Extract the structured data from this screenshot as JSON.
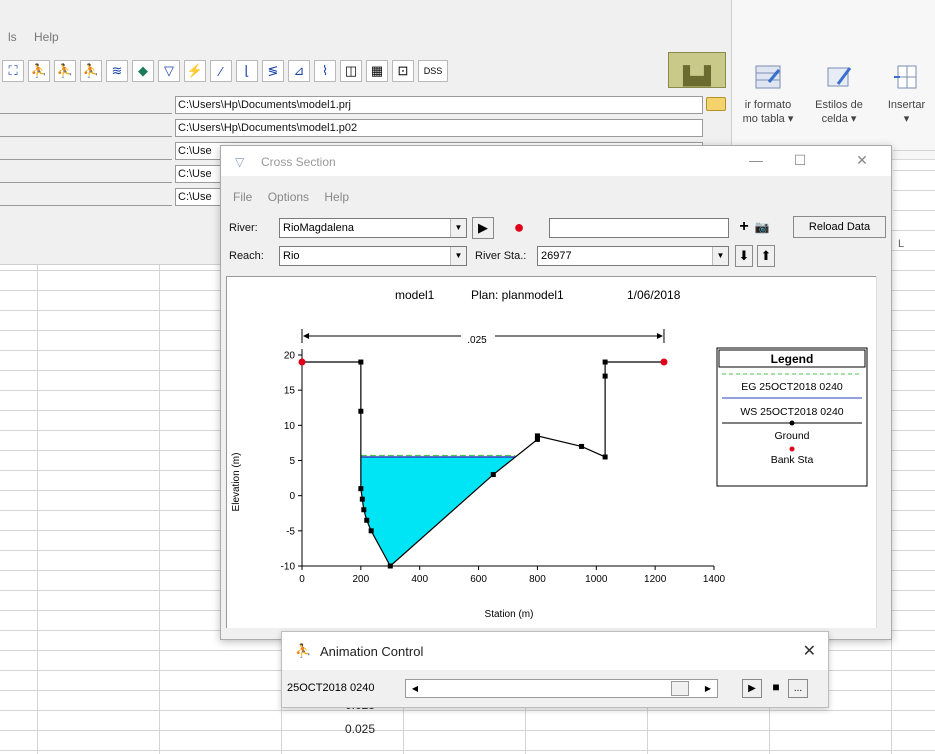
{
  "excel": {
    "ribbon_buttons": [
      {
        "line1": "ir formato",
        "line2": "mo tabla ▾"
      },
      {
        "line1": "Estilos de",
        "line2": "celda ▾"
      },
      {
        "line1": "Insertar",
        "line2": "▾"
      }
    ],
    "column_letter": "L",
    "cell_values": [
      "0.025",
      "0.025"
    ]
  },
  "hecras": {
    "menu": [
      "ls",
      "Help"
    ],
    "file_paths": [
      "C:\\Users\\Hp\\Documents\\model1.prj",
      "C:\\Users\\Hp\\Documents\\model1.p02",
      "C:\\Use",
      "C:\\Use",
      "C:\\Use"
    ],
    "dss_label": "DSS"
  },
  "cross_section": {
    "title": "Cross Section",
    "menu": [
      "File",
      "Options",
      "Help"
    ],
    "river_label": "River:",
    "river_value": "RioMagdalena",
    "reach_label": "Reach:",
    "reach_value": "Rio",
    "river_sta_label": "River Sta.:",
    "river_sta_value": "26977",
    "reload_label": "Reload Data",
    "plot_title": {
      "model": "model1",
      "plan": "Plan: planmodel1",
      "date": "1/06/2018"
    },
    "legend": {
      "title": "Legend",
      "eg": "EG 25OCT2018 0240",
      "ws": "WS 25OCT2018 0240",
      "ground": "Ground",
      "bank": "Bank Sta"
    },
    "mannings_label": ".025"
  },
  "animation": {
    "title": "Animation Control",
    "time": "25OCT2018 0240",
    "more_label": "..."
  },
  "chart_data": {
    "type": "line",
    "xlabel": "Station (m)",
    "ylabel": "Elevation (m)",
    "xlim": [
      0,
      1400
    ],
    "ylim": [
      -10,
      20
    ],
    "xticks": [
      0,
      200,
      400,
      600,
      800,
      1000,
      1200,
      1400
    ],
    "yticks": [
      -10,
      -5,
      0,
      5,
      10,
      15,
      20
    ],
    "water_surface": 5.5,
    "ground": [
      {
        "x": 0,
        "y": 19
      },
      {
        "x": 200,
        "y": 19
      },
      {
        "x": 200,
        "y": 12
      },
      {
        "x": 200,
        "y": 1
      },
      {
        "x": 205,
        "y": -0.5
      },
      {
        "x": 210,
        "y": -2
      },
      {
        "x": 220,
        "y": -3.5
      },
      {
        "x": 235,
        "y": -5
      },
      {
        "x": 300,
        "y": -10
      },
      {
        "x": 650,
        "y": 3
      },
      {
        "x": 800,
        "y": 8
      },
      {
        "x": 800,
        "y": 8.5
      },
      {
        "x": 950,
        "y": 7
      },
      {
        "x": 1030,
        "y": 5.5
      },
      {
        "x": 1030,
        "y": 17
      },
      {
        "x": 1030,
        "y": 19
      },
      {
        "x": 1230,
        "y": 19
      }
    ],
    "bank_stations": [
      {
        "x": 0,
        "y": 19
      },
      {
        "x": 1230,
        "y": 19
      }
    ],
    "colors": {
      "water": "#00e5f5",
      "ground": "#000000",
      "bank": "#e0001a",
      "eg": "#4ec44e",
      "ws": "#2a3fbf"
    }
  }
}
